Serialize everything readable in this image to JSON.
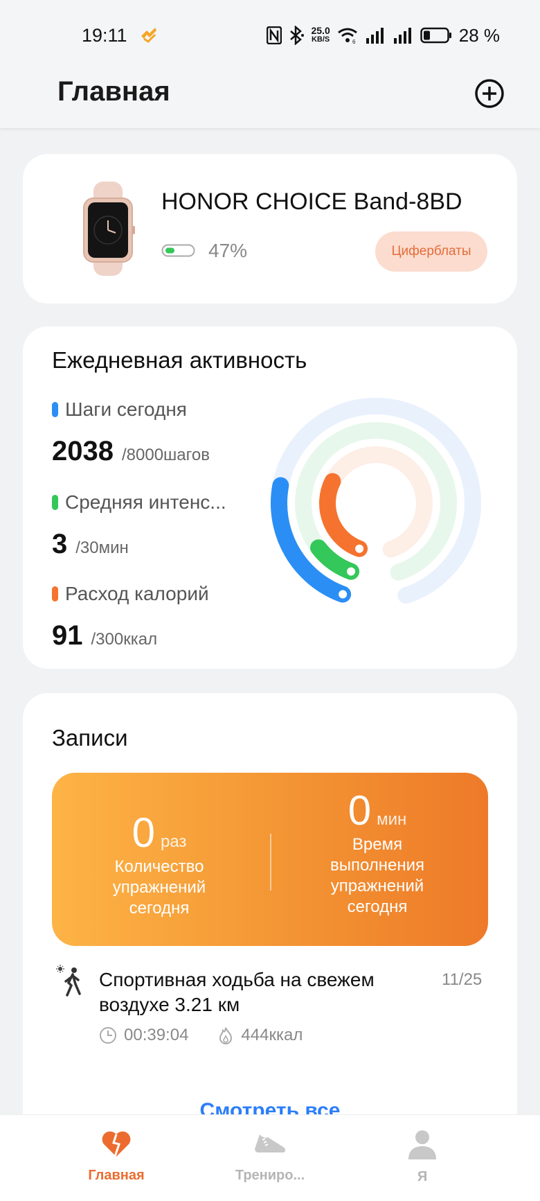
{
  "status_bar": {
    "time": "19:11",
    "net_speed_value": "25.0",
    "net_speed_unit": "KB/S",
    "battery_percent": "28 %"
  },
  "header": {
    "title": "Главная"
  },
  "device": {
    "name": "HONOR CHOICE Band-8BD",
    "battery": "47%",
    "battery_level": 0.47,
    "faces_button": "Циферблаты"
  },
  "activity": {
    "title": "Ежедневная активность",
    "steps": {
      "label": "Шаги сегодня",
      "value": "2038",
      "goal": "/8000шагов",
      "color": "#2b8ef5",
      "progress": 0.25
    },
    "intensity": {
      "label": "Средняя интенс...",
      "value": "3",
      "goal": "/30мин",
      "color": "#34c759",
      "progress": 0.1
    },
    "calories": {
      "label": "Расход калорий",
      "value": "91",
      "goal": "/300ккал",
      "color": "#f5732e",
      "progress": 0.3
    }
  },
  "records": {
    "title": "Записи",
    "count": {
      "value": "0",
      "unit": "раз",
      "desc_line1": "Количество",
      "desc_line2": "упражнений",
      "desc_line3": "сегодня"
    },
    "duration": {
      "value": "0",
      "unit": "мин",
      "desc_line1": "Время",
      "desc_line2": "выполнения",
      "desc_line3": "упражнений",
      "desc_line4": "сегодня"
    },
    "workout": {
      "title": "Спортивная ходьба на свежем воздухе 3.21 км",
      "date": "11/25",
      "duration": "00:39:04",
      "calories": "444ккал"
    },
    "view_all": "Смотреть все"
  },
  "nav": {
    "home": "Главная",
    "training": "Трениро...",
    "me": "Я"
  }
}
